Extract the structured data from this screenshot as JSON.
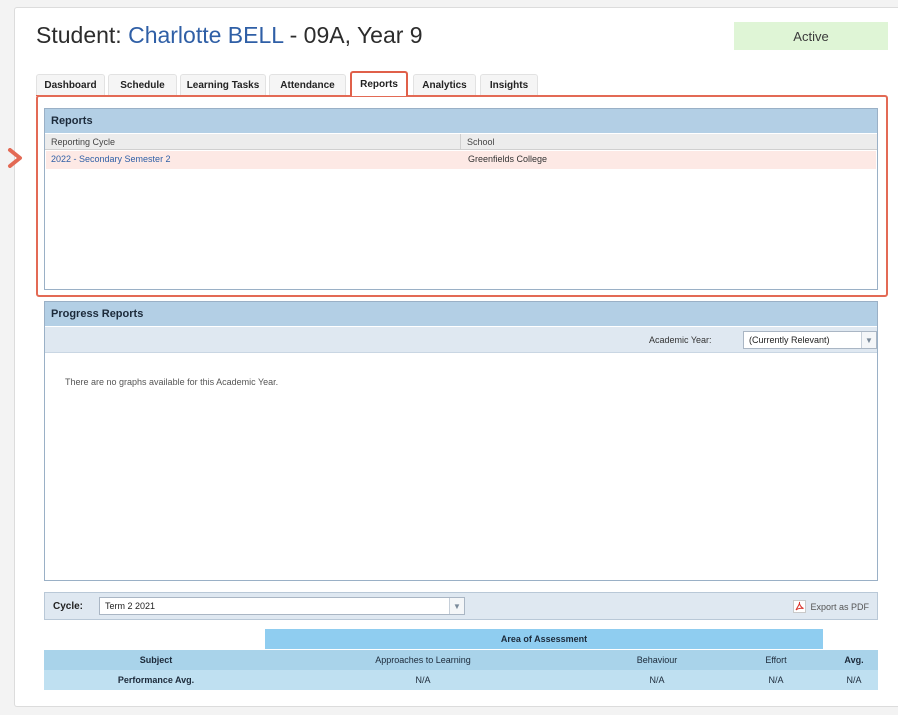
{
  "header": {
    "title_prefix": "Student: ",
    "student_name": "Charlotte BELL",
    "title_suffix": " - 09A, Year 9",
    "status": "Active"
  },
  "tabs": [
    {
      "label": "Dashboard",
      "active": false
    },
    {
      "label": "Schedule",
      "active": false
    },
    {
      "label": "Learning Tasks",
      "active": false
    },
    {
      "label": "Attendance",
      "active": false
    },
    {
      "label": "Reports",
      "active": true
    },
    {
      "label": "Analytics",
      "active": false
    },
    {
      "label": "Insights",
      "active": false
    }
  ],
  "reports": {
    "heading": "Reports",
    "columns": [
      "Reporting Cycle",
      "School"
    ],
    "rows": [
      {
        "cycle": "2022 - Secondary Semester 2",
        "school": "Greenfields College"
      }
    ]
  },
  "progress": {
    "heading": "Progress Reports",
    "academic_year_label": "Academic Year:",
    "academic_year_value": "(Currently Relevant)",
    "empty_message": "There are no graphs available for this Academic Year."
  },
  "cycle": {
    "label": "Cycle:",
    "value": "Term 2 2021",
    "export_label": "Export as PDF"
  },
  "assessment": {
    "area_heading": "Area of Assessment",
    "columns": [
      "Subject",
      "Approaches to Learning",
      "Behaviour",
      "Effort",
      "Avg."
    ],
    "performance_row": [
      "Performance Avg.",
      "N/A",
      "N/A",
      "N/A",
      "N/A"
    ]
  },
  "colors": {
    "accent_orange": "#e36a55",
    "link_blue": "#2f5fa6",
    "status_green": "#dff5d6",
    "panel_header": "#b3cfe5"
  }
}
